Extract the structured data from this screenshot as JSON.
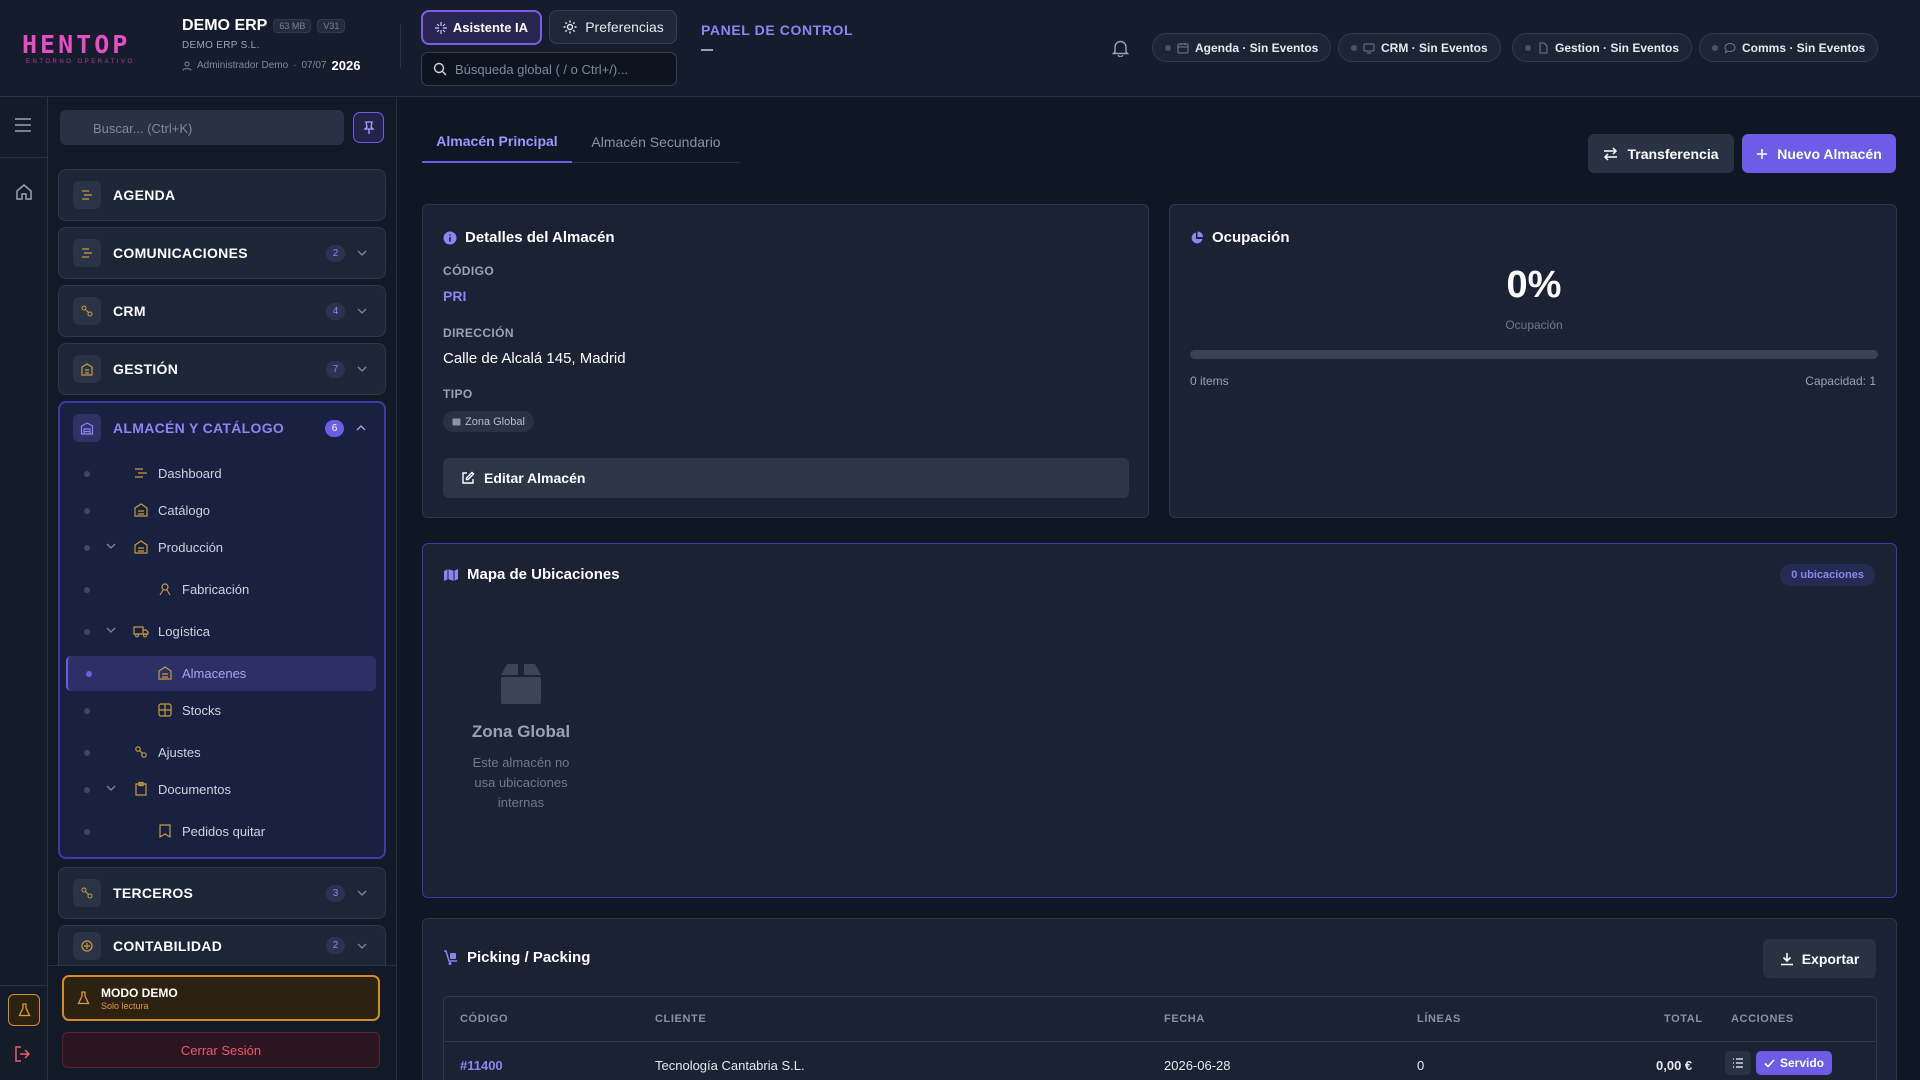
{
  "colors": {
    "accent": "#6f5ce6",
    "accent_text": "#8b86f3",
    "brand": "#e84cc7",
    "warning": "#d68a1f",
    "danger": "#f05a6c"
  },
  "header": {
    "logo": "HENTOP",
    "logo_sub": "ENTORNO OPERATIVO",
    "company": "DEMO ERP",
    "size_chip": "63 MB",
    "version_chip": "V31",
    "company_legal": "DEMO ERP S.L.",
    "user": "Administrador Demo",
    "date": "07/07",
    "year": "2026",
    "ai_button": "Asistente IA",
    "prefs_button": "Preferencias",
    "search_placeholder": "Búsqueda global ( / o Ctrl+/)...",
    "panel_title": "PANEL DE CONTROL",
    "events": [
      {
        "label": "Agenda · Sin Eventos",
        "icon": "calendar-icon"
      },
      {
        "label": "CRM · Sin Eventos",
        "icon": "monitor-icon"
      },
      {
        "label": "Gestion · Sin Eventos",
        "icon": "document-icon"
      },
      {
        "label": "Comms · Sin Eventos",
        "icon": "chat-icon"
      }
    ]
  },
  "sidebar": {
    "search_placeholder": "Buscar... (Ctrl+K)",
    "sections": [
      {
        "label": "AGENDA",
        "badge": ""
      },
      {
        "label": "COMUNICACIONES",
        "badge": "2"
      },
      {
        "label": "CRM",
        "badge": "4"
      },
      {
        "label": "GESTIÓN",
        "badge": "7"
      },
      {
        "label": "ALMACÉN Y CATÁLOGO",
        "badge": "6"
      },
      {
        "label": "TERCEROS",
        "badge": "3"
      },
      {
        "label": "CONTABILIDAD",
        "badge": "2"
      }
    ],
    "sub_items": [
      "Dashboard",
      "Catálogo",
      "Producción",
      "Fabricación",
      "Logística",
      "Almacenes",
      "Stocks",
      "Ajustes",
      "Documentos",
      "Pedidos quitar"
    ],
    "demo_title": "MODO DEMO",
    "demo_sub": "Solo lectura",
    "logout": "Cerrar Sesión"
  },
  "main": {
    "tabs": [
      "Almacén Principal",
      "Almacén Secundario"
    ],
    "transfer_button": "Transferencia",
    "new_button": "Nuevo Almacén",
    "details": {
      "title": "Detalles del Almacén",
      "code_label": "CÓDIGO",
      "code": "PRI",
      "address_label": "DIRECCIÓN",
      "address": "Calle de Alcalá 145, Madrid",
      "type_label": "TIPO",
      "type": "Zona Global",
      "edit_button": "Editar Almacén"
    },
    "occupancy": {
      "title": "Ocupación",
      "percent_text": "0%",
      "percent": 0,
      "label": "Ocupación",
      "items": "0 items",
      "capacity": "Capacidad: 1"
    },
    "map": {
      "title": "Mapa de Ubicaciones",
      "badge": "0 ubicaciones",
      "zone_title": "Zona Global",
      "zone_desc": "Este almacén no usa ubicaciones internas"
    },
    "picking": {
      "title": "Picking / Packing",
      "export_button": "Exportar",
      "columns": [
        "CÓDIGO",
        "CLIENTE",
        "FECHA",
        "LÍNEAS",
        "TOTAL",
        "ACCIONES"
      ],
      "rows": [
        {
          "code": "#11400",
          "client": "Tecnología Cantabria S.L.",
          "date": "2026-06-28",
          "lines": "0",
          "total": "0,00 €",
          "status": "Servido"
        }
      ]
    }
  }
}
